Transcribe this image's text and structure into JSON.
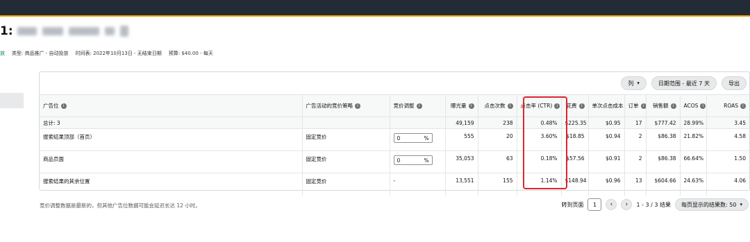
{
  "header": {
    "title_prefix": "1:",
    "meta": {
      "status": "放",
      "type": "类型: 商品推广 - 自动投放",
      "schedule": "时间表: 2022年10月13日 - 无结束日期",
      "budget": "预算: $40.00 - 每天"
    }
  },
  "toolbar": {
    "columns_label": "列",
    "date_range_label": "日期范围 - 最近 7 天",
    "export_label": "导出"
  },
  "table": {
    "headers": [
      "广告位",
      "广告活动的竞价策略",
      "竞价调整",
      "曝光量",
      "点击次数",
      "点击率 (CTR)",
      "花费",
      "单次点击成本",
      "订单",
      "销售额",
      "ACOS",
      "ROAS"
    ],
    "total": {
      "label": "总计: 3",
      "impressions": "49,159",
      "clicks": "238",
      "ctr": "0.48%",
      "spend": "$225.35",
      "cpc": "$0.95",
      "orders": "17",
      "sales": "$777.42",
      "acos": "28.99%",
      "roas": "3.45"
    },
    "rows": [
      {
        "placement": "搜索结果顶部（首页）",
        "strategy": "固定竞价",
        "bid_value": "0",
        "bid_unit": "%",
        "impressions": "555",
        "clicks": "20",
        "ctr": "3.60%",
        "spend": "$18.85",
        "cpc": "$0.94",
        "orders": "2",
        "sales": "$86.38",
        "acos": "21.82%",
        "roas": "4.58"
      },
      {
        "placement": "商品页面",
        "strategy": "固定竞价",
        "bid_value": "0",
        "bid_unit": "%",
        "impressions": "35,053",
        "clicks": "63",
        "ctr": "0.18%",
        "spend": "$57.56",
        "cpc": "$0.91",
        "orders": "2",
        "sales": "$86.38",
        "acos": "66.64%",
        "roas": "1.50"
      },
      {
        "placement": "搜索结果的其余位置",
        "strategy": "固定竞价",
        "bid_value": "-",
        "impressions": "13,551",
        "clicks": "155",
        "ctr": "1.14%",
        "spend": "$148.94",
        "cpc": "$0.96",
        "orders": "13",
        "sales": "$604.66",
        "acos": "24.63%",
        "roas": "4.06"
      }
    ]
  },
  "footer": {
    "note": "竞价调整数据是最新的，但其他广告位数据可能会延迟长达 12 小时。",
    "goto_label": "转到页面",
    "page_value": "1",
    "range_label": "1 - 3 / 3 结果",
    "per_page_label": "每页显示的结果数:  50"
  },
  "icons": {
    "info": "info-circle-icon",
    "chevron": "chevron-down-icon",
    "prev": "chevron-left-icon",
    "next": "chevron-right-icon"
  },
  "colors": {
    "highlight": "#e0242c",
    "topbar": "#222b36",
    "accent": "#ff9900"
  }
}
